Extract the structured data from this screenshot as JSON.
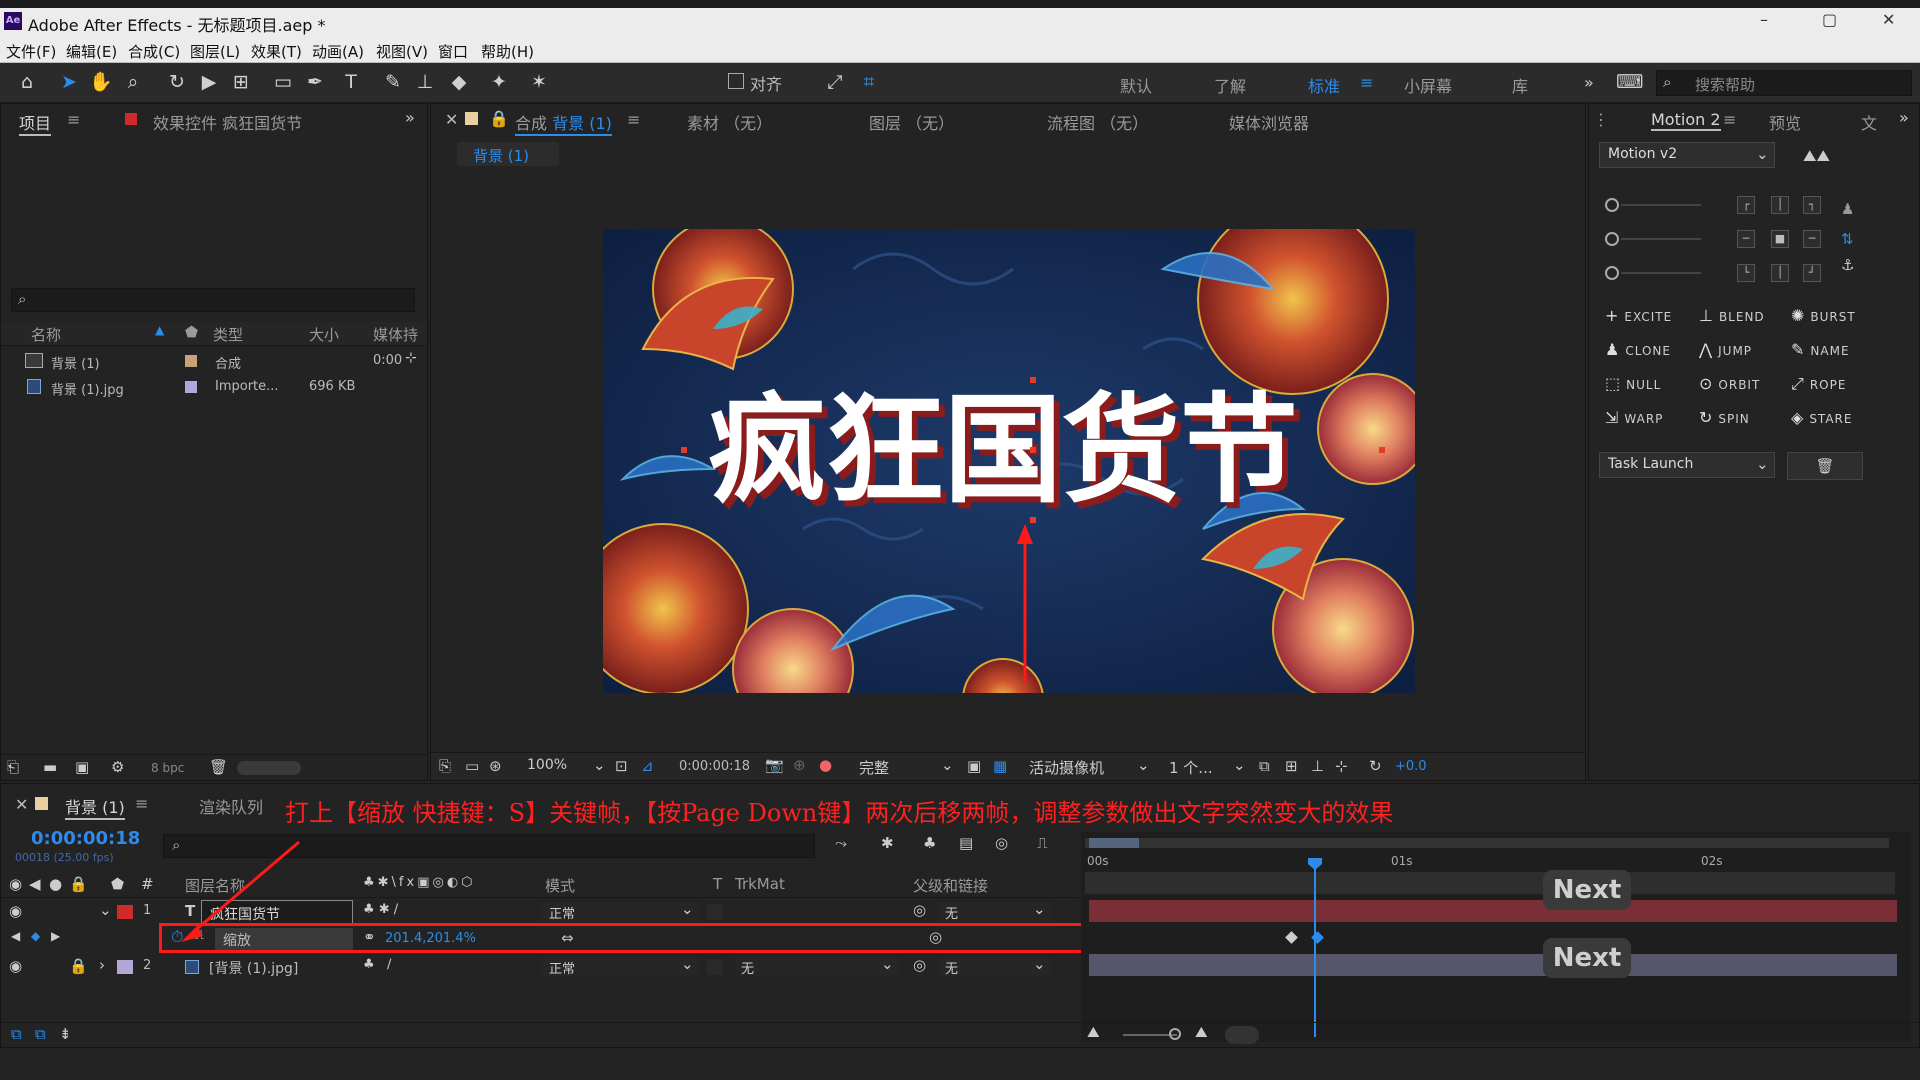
{
  "window": {
    "logo": "Ae",
    "title": "Adobe After Effects - 无标题项目.aep *",
    "min": "–",
    "max": "▢",
    "close": "✕"
  },
  "menu": [
    "文件(F)",
    "编辑(E)",
    "合成(C)",
    "图层(L)",
    "效果(T)",
    "动画(A)",
    "视图(V)",
    "窗口",
    "帮助(H)"
  ],
  "toolbar": {
    "align_label": "对齐",
    "workspaces": [
      "默认",
      "了解",
      "标准",
      "小屏幕",
      "库"
    ],
    "active_workspace": "标准",
    "search_placeholder": "搜索帮助"
  },
  "project_panel": {
    "tab": "项目",
    "effects_tab": "效果控件 疯狂国货节",
    "columns": [
      "名称",
      "类型",
      "大小",
      "媒体持"
    ],
    "items": [
      {
        "name": "背景 (1)",
        "type": "合成",
        "size": "",
        "duration": "0:00"
      },
      {
        "name": "背景 (1).jpg",
        "type": "Importe...",
        "size": "696 KB",
        "duration": ""
      }
    ],
    "bpc": "8 bpc"
  },
  "viewer": {
    "tabs": [
      "合成 背景 (1)",
      "素材 （无）",
      "图层 （无）",
      "流程图 （无）",
      "媒体浏览器"
    ],
    "comp_prefix": "合成",
    "comp_name": "背景 (1)",
    "breadcrumb": "背景 (1)",
    "title_text": "疯狂国货节",
    "zoom": "100%",
    "timecode": "0:00:00:18",
    "resolution": "完整",
    "camera": "活动摄像机",
    "views": "1 个...",
    "exposure": "+0.0"
  },
  "motion_panel": {
    "tab": "Motion 2",
    "preview_tab": "预览",
    "preset": "Motion v2",
    "buttons": [
      [
        "EXCITE",
        "BLEND",
        "BURST"
      ],
      [
        "CLONE",
        "JUMP",
        "NAME"
      ],
      [
        "NULL",
        "ORBIT",
        "ROPE"
      ],
      [
        "WARP",
        "SPIN",
        "STARE"
      ]
    ],
    "task": "Task Launch"
  },
  "timeline": {
    "comp_tab": "背景 (1)",
    "render_tab": "渲染队列",
    "timecode": "0:00:00:18",
    "frame_info": "00018 (25.00 fps)",
    "instruction": "打上【缩放 快捷键：S】关键帧，【按Page Down键】两次后移两帧，调整参数做出文字突然变大的效果",
    "columns": {
      "layer_name": "图层名称",
      "mode": "模式",
      "t": "T",
      "trkmat": "TrkMat",
      "parent": "父级和链接"
    },
    "ruler": [
      "00s",
      "01s",
      "02s"
    ],
    "layers": [
      {
        "num": "1",
        "name": "疯狂国货节",
        "mode": "正常",
        "trkmat": "",
        "parent": "无"
      },
      {
        "num": "2",
        "name": "[背景 (1).jpg]",
        "mode": "正常",
        "trkmat": "无",
        "parent": "无"
      }
    ],
    "property": {
      "name": "缩放",
      "value": "201.4,201.4%"
    },
    "next_label": "Next"
  }
}
